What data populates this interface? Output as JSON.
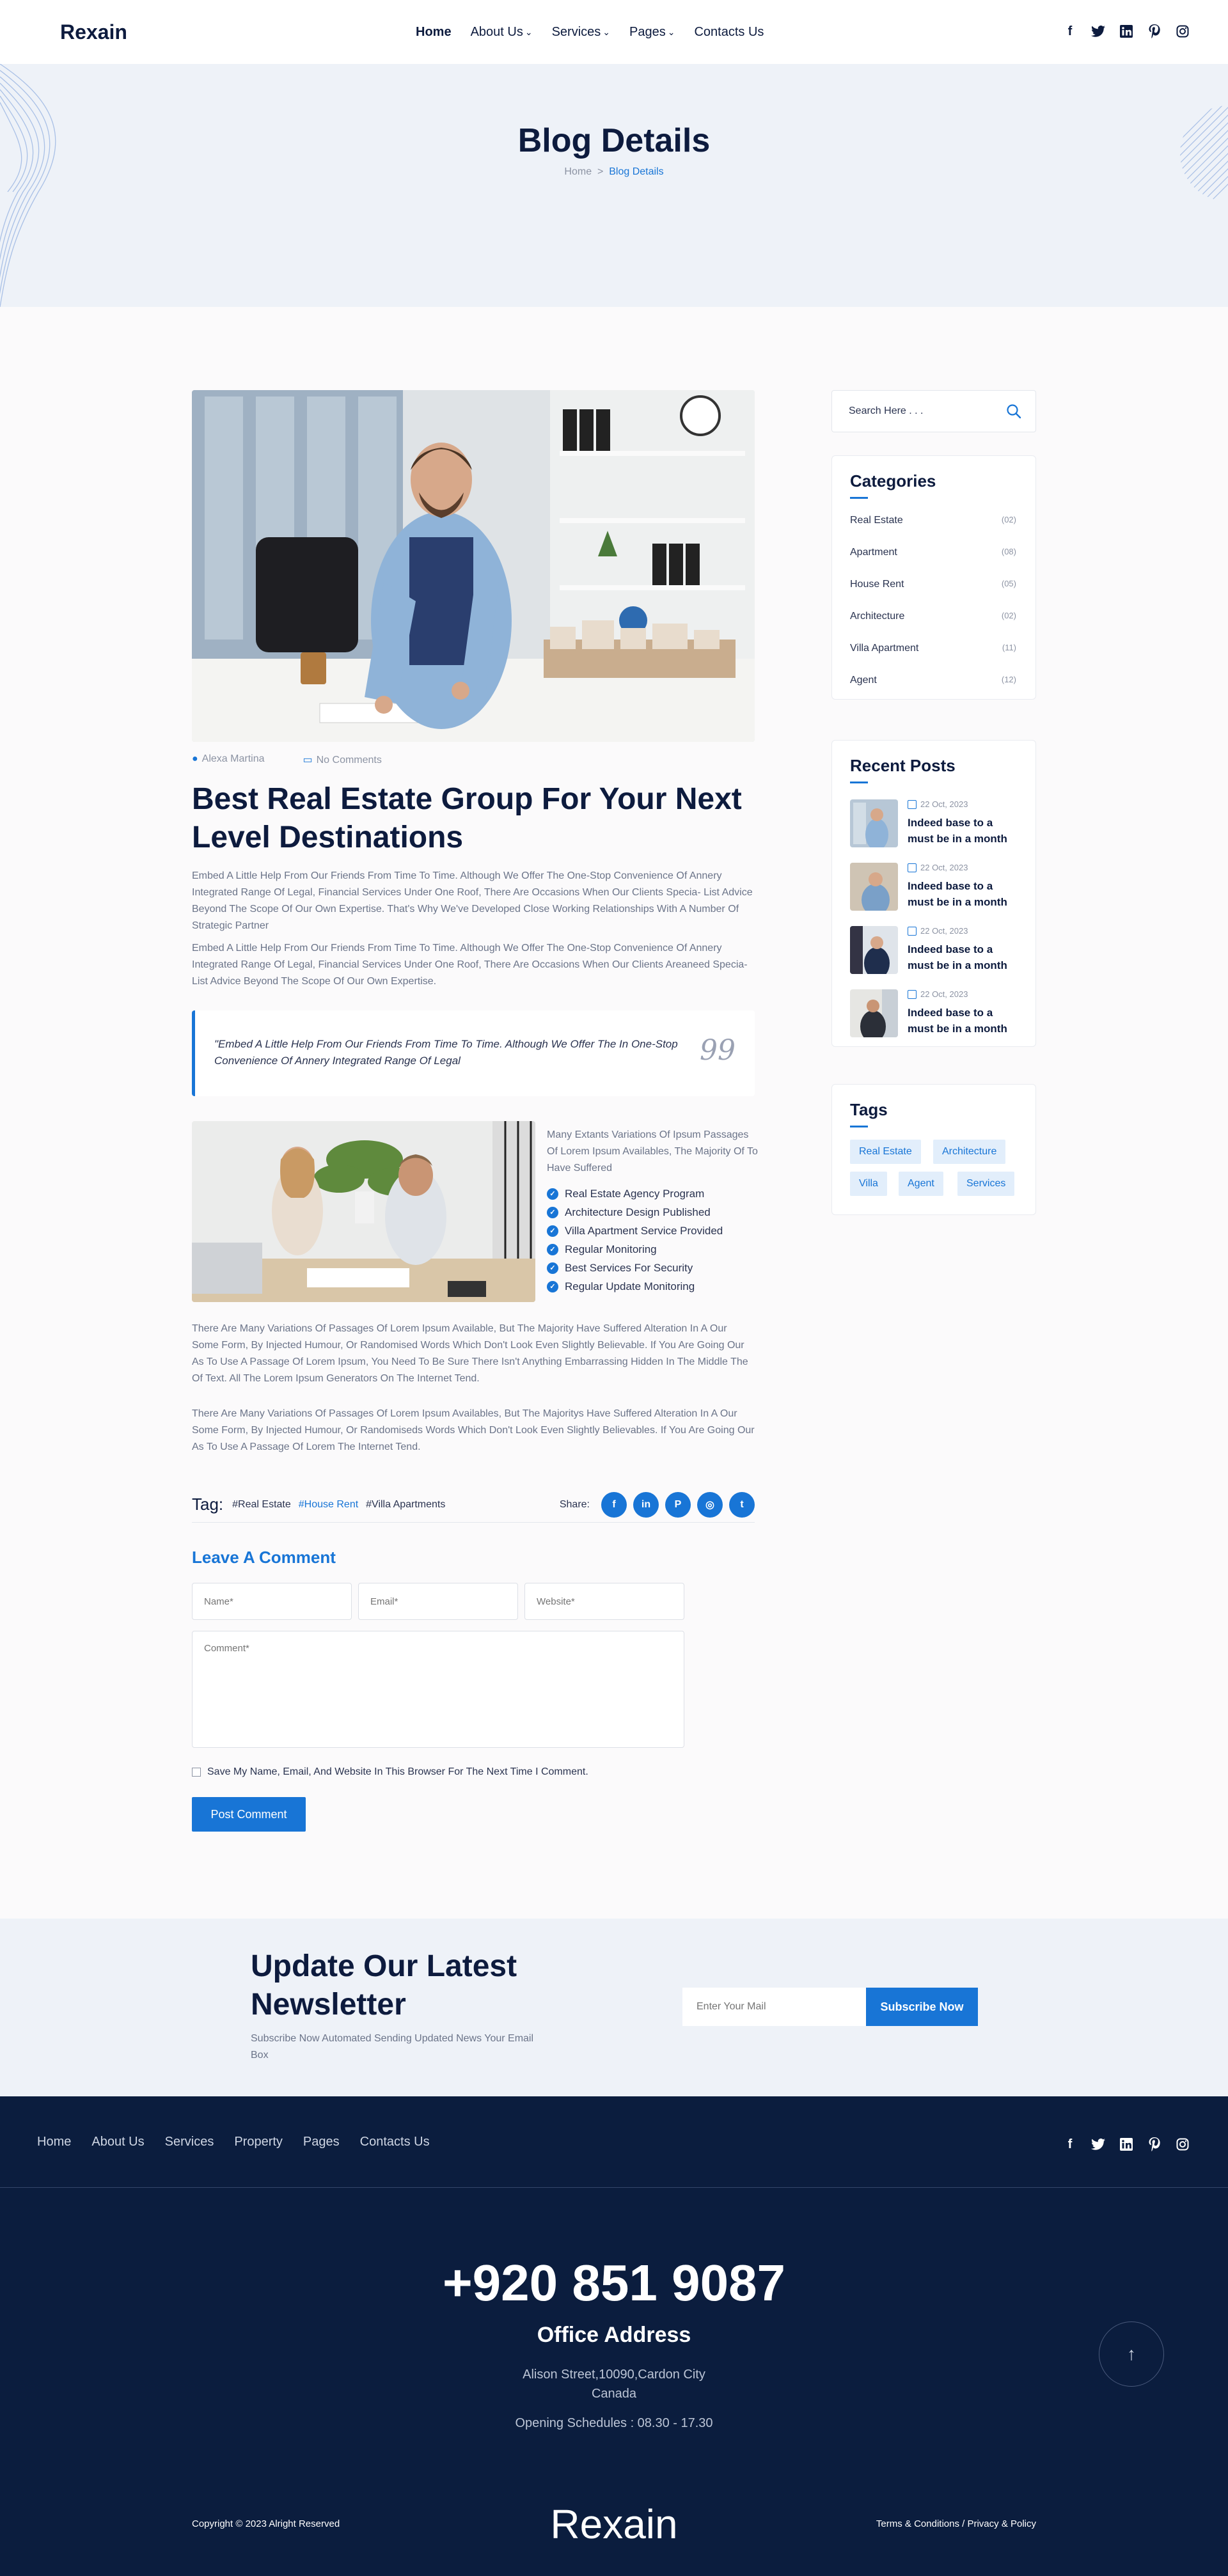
{
  "header": {
    "logo": "Rexain",
    "nav": [
      {
        "label": "Home",
        "dropdown": false
      },
      {
        "label": "About Us",
        "dropdown": true
      },
      {
        "label": "Services",
        "dropdown": true
      },
      {
        "label": "Pages",
        "dropdown": true
      },
      {
        "label": "Contacts Us",
        "dropdown": false
      }
    ],
    "social_icons": [
      "facebook-icon",
      "twitter-icon",
      "linkedin-icon",
      "pinterest-icon",
      "instagram-icon"
    ]
  },
  "hero": {
    "title": "Blog Details",
    "breadcrumb_home": "Home",
    "breadcrumb_sep": ">",
    "breadcrumb_current": "Blog Details"
  },
  "post": {
    "author": "Alexa Martina",
    "comments": "No Comments",
    "title": "Best Real Estate Group For Your Next Level Destinations",
    "para1": "Embed A Little Help From Our Friends From Time To Time. Although We Offer The One-Stop Convenience Of Annery Integrated Range Of Legal, Financial Services Under One Roof, There Are Occasions When Our Clients Specia- List Advice Beyond The Scope Of Our Own Expertise. That's Why We've Developed Close Working Relationships With A Number Of Strategic Partner",
    "para2": "Embed A Little Help From Our Friends From Time To Time. Although We Offer The One-Stop Convenience Of Annery Integrated Range Of Legal, Financial Services Under One Roof, There Are Occasions When Our Clients Areaneed Specia- List Advice Beyond The Scope Of Our Own Expertise.",
    "quote": "\"Embed A Little Help From Our Friends From Time To Time. Although We Offer The In One-Stop Convenience Of Annery Integrated Range Of Legal",
    "side_text": "Many Extants Variations Of Ipsum Passages Of Lorem Ipsum Availables, The Majority Of To Have Suffered",
    "checklist": [
      "Real Estate Agency Program",
      "Architecture Design Published",
      "Villa Apartment Service Provided",
      "Regular Monitoring",
      "Best Services For Security",
      "Regular Update Monitoring"
    ],
    "para3": "There Are Many Variations Of Passages Of Lorem Ipsum Available, But The Majority Have Suffered Alteration In A Our Some Form, By Injected Humour, Or Randomised Words Which Don't Look Even Slightly Believable. If You Are Going Our As To Use A Passage Of Lorem Ipsum, You Need To Be Sure There Isn't Anything Embarrassing Hidden In The Middle The Of Text. All The Lorem Ipsum Generators On The Internet Tend.",
    "para4": "There Are Many Variations Of Passages Of Lorem Ipsum Availables, But The Majoritys Have Suffered Alteration In A Our Some Form, By Injected Humour, Or Randomiseds Words Which Don't Look Even Slightly Believables. If You Are Going Our As To Use A Passage Of Lorem The Internet Tend.",
    "tag_label": "Tag:",
    "tags": [
      "#Real Estate",
      "#House Rent",
      "#Villa Apartments"
    ],
    "share_label": "Share:",
    "share_icons": [
      "facebook-icon",
      "linkedin-icon",
      "pinterest-icon",
      "instagram-icon",
      "twitter-icon"
    ]
  },
  "comment_form": {
    "title": "Leave A Comment",
    "name_placeholder": "Name*",
    "email_placeholder": "Email*",
    "website_placeholder": "Website*",
    "comment_placeholder": "Comment*",
    "save_label": "Save My Name, Email, And Website In This Browser For The Next Time I Comment.",
    "submit_label": "Post Comment"
  },
  "sidebar": {
    "search_placeholder": "Search Here . . .",
    "categories_title": "Categories",
    "categories": [
      {
        "name": "Real Estate",
        "count": "(02)"
      },
      {
        "name": "Apartment",
        "count": "(08)"
      },
      {
        "name": "House Rent",
        "count": "(05)"
      },
      {
        "name": "Architecture",
        "count": "(02)"
      },
      {
        "name": "Villa Apartment",
        "count": "(11)"
      },
      {
        "name": "Agent",
        "count": "(12)"
      }
    ],
    "recent_title": "Recent Posts",
    "recent_posts": [
      {
        "date": "22 Oct, 2023",
        "title": "Indeed base to a must  be in a month"
      },
      {
        "date": "22 Oct, 2023",
        "title": "Indeed base to a must  be in a month"
      },
      {
        "date": "22 Oct, 2023",
        "title": "Indeed base to a must  be in a month"
      },
      {
        "date": "22 Oct, 2023",
        "title": "Indeed base to a must  be in a month"
      }
    ],
    "tags_title": "Tags",
    "tags": [
      "Real Estate",
      "Architecture",
      "Villa",
      "Agent",
      "Services"
    ]
  },
  "newsletter": {
    "title": "Update Our Latest Newsletter",
    "subtitle": "Subscribe Now Automated Sending Updated News Your Email Box",
    "placeholder": "Enter Your Mail",
    "button": "Subscribe Now"
  },
  "footer": {
    "nav": [
      "Home",
      "About Us",
      "Services",
      "Property",
      "Pages",
      "Contacts Us"
    ],
    "phone": "+920 851 9087",
    "office_title": "Office Address",
    "address_line1": "Alison Street,10090,Cardon City",
    "address_line2": "Canada",
    "schedule": "Opening Schedules : 08.30 - 17.30",
    "copyright": "Copyright © 2023 Alright Reserved",
    "logo": "Rexain",
    "terms": "Terms & Conditions / Privacy & Policy"
  },
  "colors": {
    "accent": "#1875d6",
    "navy": "#0d1b3e",
    "footer_bg": "#0b1d3e",
    "light_bg": "#eef2f8"
  }
}
